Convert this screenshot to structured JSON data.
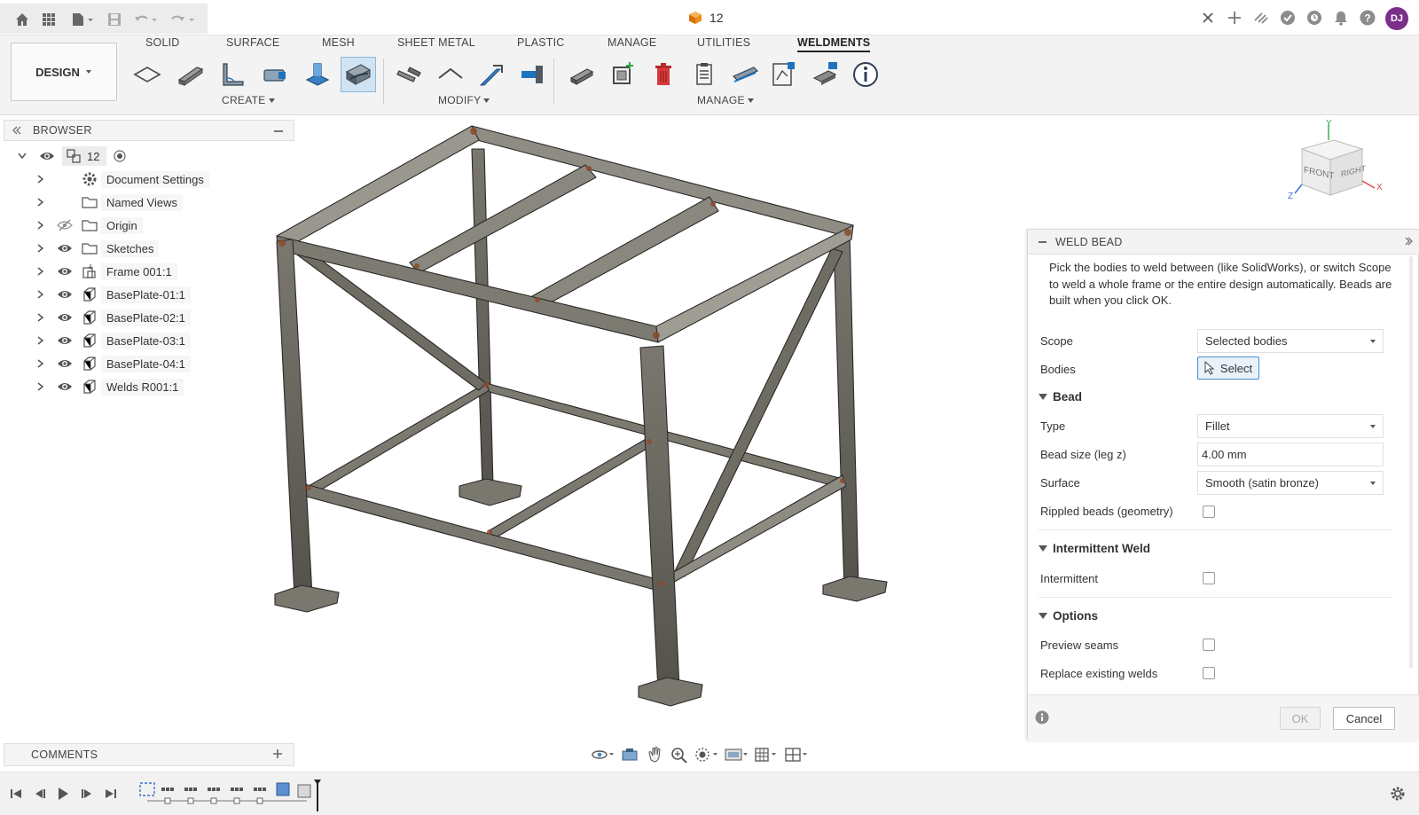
{
  "app": {
    "document_name": "12",
    "user_initials": "DJ"
  },
  "quick_access": {
    "icons": [
      "home-icon",
      "grid-icon",
      "file-icon",
      "save-icon",
      "undo-icon",
      "redo-icon"
    ]
  },
  "top_right_icons": [
    "close-tab-icon",
    "new-tab-icon",
    "extensions-icon",
    "job-status-icon",
    "online-icon",
    "notifications-icon",
    "help-icon"
  ],
  "ribbon": {
    "workspace": "DESIGN",
    "tabs": [
      "SOLID",
      "SURFACE",
      "MESH",
      "SHEET METAL",
      "PLASTIC",
      "MANAGE",
      "UTILITIES",
      "WELDMENTS"
    ],
    "active_tab": "WELDMENTS",
    "groups": {
      "create": "CREATE",
      "modify": "MODIFY",
      "manage": "MANAGE"
    }
  },
  "browser": {
    "title": "BROWSER",
    "root": "12",
    "items": [
      {
        "label": "Document Settings",
        "icon": "gear-icon",
        "eye": false
      },
      {
        "label": "Named Views",
        "icon": "folder-icon",
        "eye": false
      },
      {
        "label": "Origin",
        "icon": "folder-icon",
        "eye": "hidden"
      },
      {
        "label": "Sketches",
        "icon": "folder-icon",
        "eye": true
      },
      {
        "label": "Frame 001:1",
        "icon": "component-icon",
        "eye": true
      },
      {
        "label": "BasePlate-01:1",
        "icon": "body-icon",
        "eye": true
      },
      {
        "label": "BasePlate-02:1",
        "icon": "body-icon",
        "eye": true
      },
      {
        "label": "BasePlate-03:1",
        "icon": "body-icon",
        "eye": true
      },
      {
        "label": "BasePlate-04:1",
        "icon": "body-icon",
        "eye": true
      },
      {
        "label": "Welds R001:1",
        "icon": "body-icon",
        "eye": true
      }
    ]
  },
  "viewcube": {
    "front": "FRONT",
    "right": "RIGHT",
    "axis_x": "X",
    "axis_y": "Y",
    "axis_z": "Z"
  },
  "weld_dialog": {
    "title": "WELD BEAD",
    "description": "Pick the bodies to weld between (like SolidWorks), or switch Scope to weld a whole frame or the entire design automatically. Beads are built when you click OK.",
    "scope_label": "Scope",
    "scope_value": "Selected bodies",
    "bodies_label": "Bodies",
    "select_label": "Select",
    "bead_section": "Bead",
    "type_label": "Type",
    "type_value": "Fillet",
    "size_label": "Bead size (leg z)",
    "size_value": "4.00 mm",
    "surface_label": "Surface",
    "surface_value": "Smooth (satin bronze)",
    "rippled_label": "Rippled beads (geometry)",
    "intermittent_section": "Intermittent Weld",
    "intermittent_label": "Intermittent",
    "options_section": "Options",
    "preview_label": "Preview seams",
    "replace_label": "Replace existing welds",
    "ok_label": "OK",
    "cancel_label": "Cancel"
  },
  "comments": {
    "title": "COMMENTS"
  }
}
